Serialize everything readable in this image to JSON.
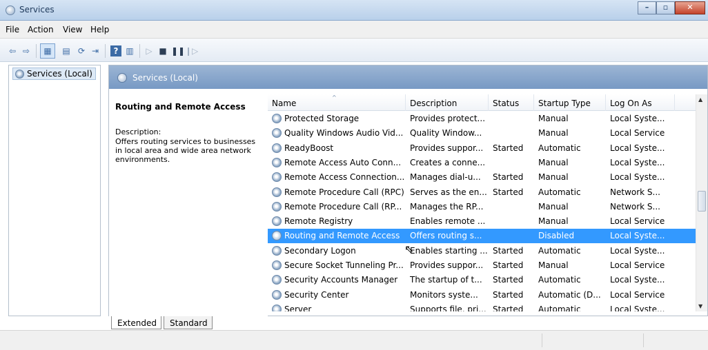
{
  "window": {
    "title": "Services",
    "minimize_icon": "minimize-icon",
    "maximize_icon": "maximize-icon",
    "close_icon": "close-icon"
  },
  "menu": [
    "File",
    "Action",
    "View",
    "Help"
  ],
  "toolbar": {
    "icons": [
      "back-arrow-icon",
      "forward-arrow-icon",
      "show-hide-console-tree-icon",
      "properties-icon",
      "refresh-icon",
      "export-list-icon",
      "help-icon",
      "show-hide-action-pane-icon",
      "start-service-icon",
      "stop-service-icon",
      "pause-service-icon",
      "resume-service-icon"
    ]
  },
  "tree": {
    "items": [
      {
        "label": "Services (Local)",
        "icon": "services-gear-icon",
        "selected": true
      }
    ]
  },
  "panel": {
    "header": "Services (Local)",
    "detail": {
      "title": "Routing and Remote Access",
      "description_label": "Description:",
      "description": "Offers routing services to businesses in local area and wide area network environments."
    }
  },
  "list": {
    "columns": [
      "Name",
      "Description",
      "Status",
      "Startup Type",
      "Log On As"
    ],
    "sort_indicator": "^",
    "rows": [
      {
        "name": "Protected Storage",
        "description": "Provides protect...",
        "status": "",
        "startup": "Manual",
        "logon": "Local Syste..."
      },
      {
        "name": "Quality Windows Audio Vid...",
        "description": "Quality Window...",
        "status": "",
        "startup": "Manual",
        "logon": "Local Service"
      },
      {
        "name": "ReadyBoost",
        "description": "Provides suppor...",
        "status": "Started",
        "startup": "Automatic",
        "logon": "Local Syste..."
      },
      {
        "name": "Remote Access Auto Conn...",
        "description": "Creates a conne...",
        "status": "",
        "startup": "Manual",
        "logon": "Local Syste..."
      },
      {
        "name": "Remote Access Connection...",
        "description": "Manages dial-u...",
        "status": "Started",
        "startup": "Manual",
        "logon": "Local Syste..."
      },
      {
        "name": "Remote Procedure Call (RPC)",
        "description": "Serves as the en...",
        "status": "Started",
        "startup": "Automatic",
        "logon": "Network S..."
      },
      {
        "name": "Remote Procedure Call (RP...",
        "description": "Manages the RP...",
        "status": "",
        "startup": "Manual",
        "logon": "Network S..."
      },
      {
        "name": "Remote Registry",
        "description": "Enables remote ...",
        "status": "",
        "startup": "Manual",
        "logon": "Local Service"
      },
      {
        "name": "Routing and Remote Access",
        "description": "Offers routing s...",
        "status": "",
        "startup": "Disabled",
        "logon": "Local Syste...",
        "selected": true
      },
      {
        "name": "Secondary Logon",
        "description": "Enables starting ...",
        "status": "Started",
        "startup": "Automatic",
        "logon": "Local Syste..."
      },
      {
        "name": "Secure Socket Tunneling Pr...",
        "description": "Provides suppor...",
        "status": "Started",
        "startup": "Manual",
        "logon": "Local Service"
      },
      {
        "name": "Security Accounts Manager",
        "description": "The startup of t...",
        "status": "Started",
        "startup": "Automatic",
        "logon": "Local Syste..."
      },
      {
        "name": "Security Center",
        "description": "Monitors syste...",
        "status": "Started",
        "startup": "Automatic (D...",
        "logon": "Local Service"
      },
      {
        "name": "Server",
        "description": "Supports file, pri...",
        "status": "Started",
        "startup": "Automatic",
        "logon": "Local Syste..."
      }
    ]
  },
  "tabs": [
    "Extended",
    "Standard"
  ],
  "colors": {
    "selection": "#3399ff",
    "header_gradient_top": "#9cb5d4",
    "header_gradient_bottom": "#7799c4"
  }
}
